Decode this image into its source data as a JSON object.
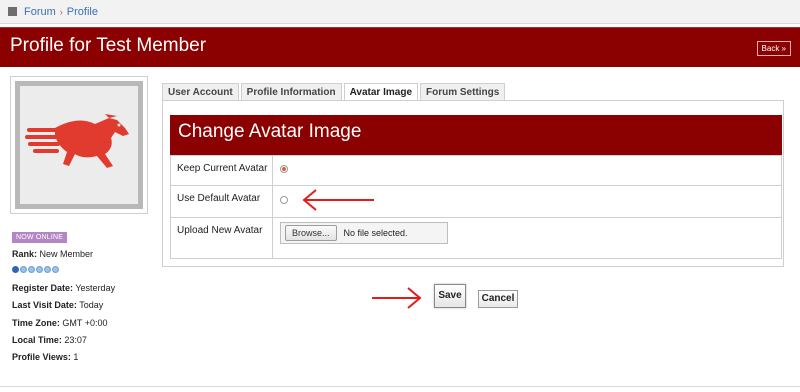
{
  "breadcrumb": {
    "items": [
      "Forum",
      "Profile"
    ],
    "separator": "›",
    "icon": "home-icon"
  },
  "header": {
    "title": "Profile for Test Member",
    "back_label": "Back »"
  },
  "colors": {
    "brand": "#8b0000",
    "badge": "#b486c4",
    "accent": "#d9603a",
    "annotation_arrow": "#e21c1c"
  },
  "profile": {
    "avatar_icon": "horse-logo-icon",
    "status_badge": "NOW ONLINE",
    "rank_label": "Rank:",
    "rank_value": "New Member",
    "rank_level": 1,
    "rank_max": 6,
    "register_label": "Register Date:",
    "register_value": "Yesterday",
    "last_visit_label": "Last Visit Date:",
    "last_visit_value": "Today",
    "timezone_label": "Time Zone:",
    "timezone_value": "GMT +0:00",
    "localtime_label": "Local Time:",
    "localtime_value": "23:07",
    "views_label": "Profile Views:",
    "views_value": "1"
  },
  "tabs": [
    {
      "label": "User Account",
      "active": false
    },
    {
      "label": "Profile Information",
      "active": false
    },
    {
      "label": "Avatar Image",
      "active": true
    },
    {
      "label": "Forum Settings",
      "active": false
    }
  ],
  "avatar_form": {
    "title": "Change Avatar Image",
    "keep_label": "Keep Current Avatar",
    "keep_selected": true,
    "default_label": "Use Default Avatar",
    "default_selected": false,
    "upload_label": "Upload New Avatar",
    "browse_label": "Browse...",
    "file_status": "No file selected."
  },
  "buttons": {
    "save": "Save",
    "cancel": "Cancel"
  }
}
